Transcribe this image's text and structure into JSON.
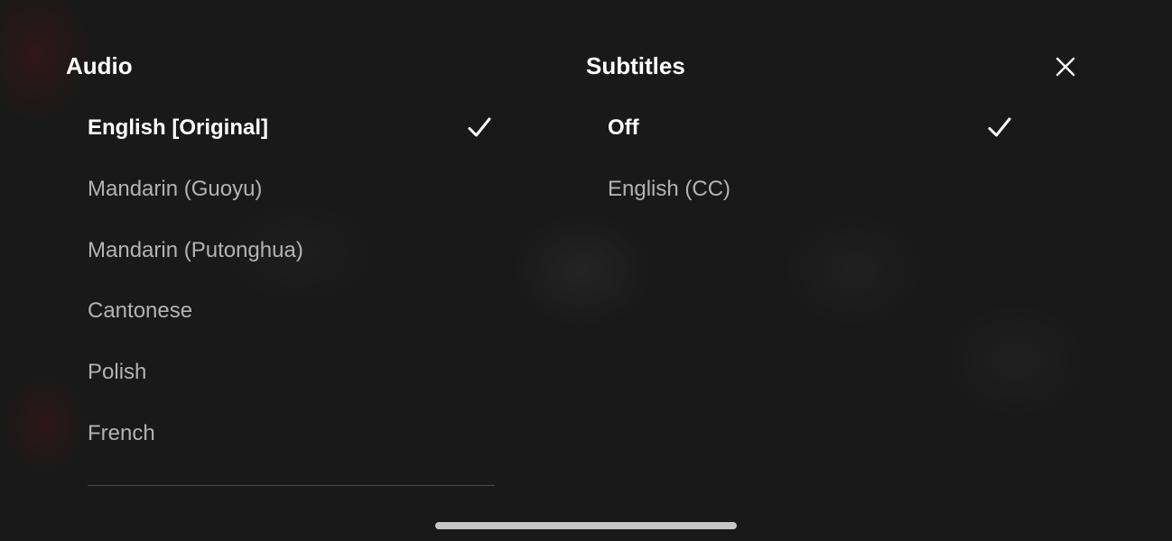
{
  "audio": {
    "title": "Audio",
    "options": [
      {
        "label": "English [Original]",
        "selected": true
      },
      {
        "label": "Mandarin (Guoyu)",
        "selected": false
      },
      {
        "label": "Mandarin (Putonghua)",
        "selected": false
      },
      {
        "label": "Cantonese",
        "selected": false
      },
      {
        "label": "Polish",
        "selected": false
      },
      {
        "label": "French",
        "selected": false
      }
    ]
  },
  "subtitles": {
    "title": "Subtitles",
    "options": [
      {
        "label": "Off",
        "selected": true
      },
      {
        "label": "English (CC)",
        "selected": false
      }
    ]
  },
  "icons": {
    "close": "close-icon",
    "check": "check-icon"
  },
  "colors": {
    "background": "#1a1a1a",
    "selected_text": "#ffffff",
    "unselected_text": "#b3b3b3"
  }
}
